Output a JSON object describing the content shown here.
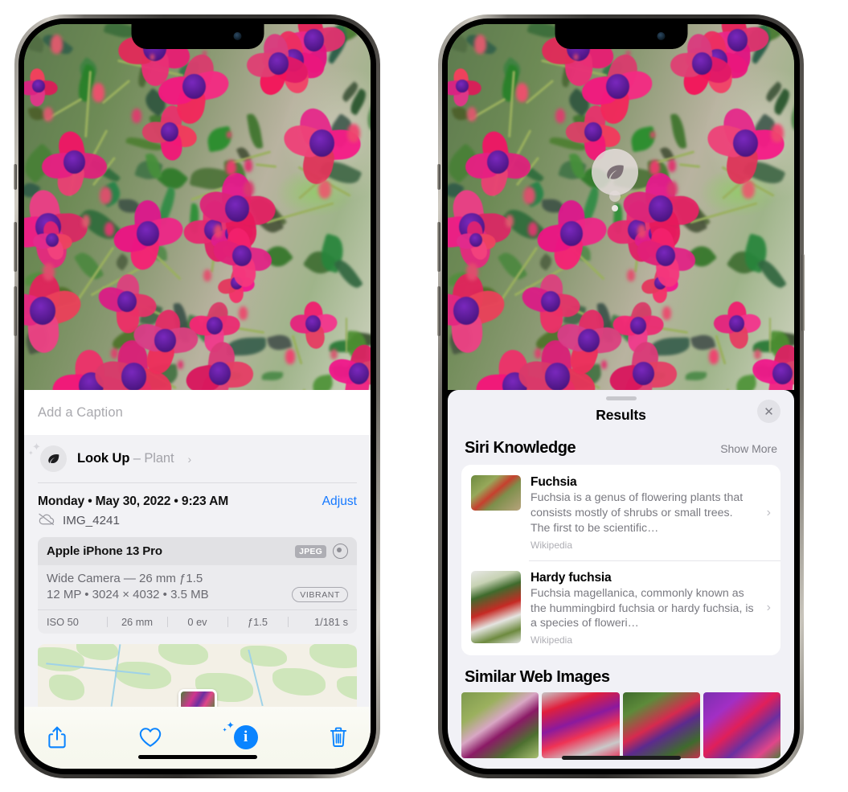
{
  "left_phone": {
    "caption_field": {
      "placeholder": "Add a Caption",
      "value": ""
    },
    "lookup_row": {
      "icon": "leaf-icon",
      "sparkle_icon": "sparkles-icon",
      "label": "Look Up",
      "separator": "–",
      "subject": "Plant",
      "chevron": "›"
    },
    "date_row": {
      "datetime": "Monday • May 30, 2022 • 9:23 AM",
      "adjust_label": "Adjust"
    },
    "filename_row": {
      "icon": "cloud-slash-icon",
      "filename": "IMG_4241"
    },
    "exif": {
      "device": "Apple iPhone 13 Pro",
      "format_badge": "JPEG",
      "aperture_icon": "aperture-icon",
      "lens_line": "Wide Camera — 26 mm ƒ1.5",
      "size_line": "12 MP • 3024 × 4032 • 3.5 MB",
      "style_badge": "VIBRANT",
      "stats": [
        "ISO 50",
        "26 mm",
        "0 ev",
        "ƒ1.5",
        "1/181 s"
      ]
    },
    "map": {
      "pin": "photo-thumbnail-pin"
    },
    "toolbar": [
      {
        "name": "share-icon",
        "glyph": "share"
      },
      {
        "name": "favorite-heart-icon",
        "glyph": "heart"
      },
      {
        "name": "info-icon",
        "glyph": "info",
        "badge_char": "i",
        "active": true
      },
      {
        "name": "trash-icon",
        "glyph": "trash"
      }
    ]
  },
  "right_phone": {
    "visual_lookup_badge": {
      "icon": "leaf-icon"
    },
    "sheet": {
      "grabber": "drag-handle",
      "title": "Results",
      "close_label": "✕"
    },
    "siri_knowledge": {
      "heading": "Siri Knowledge",
      "show_more": "Show More",
      "items": [
        {
          "title": "Fuchsia",
          "description": "Fuchsia is a genus of flowering plants that consists mostly of shrubs or small trees. The first to be scientific…",
          "source": "Wikipedia",
          "chevron": "›"
        },
        {
          "title": "Hardy fuchsia",
          "description": "Fuchsia magellanica, commonly known as the hummingbird fuchsia or hardy fuchsia, is a species of floweri…",
          "source": "Wikipedia",
          "chevron": "›"
        }
      ]
    },
    "similar_web_images": {
      "heading": "Similar Web Images",
      "count": 4
    }
  },
  "colors": {
    "accent_blue": "#0a84ff",
    "sheet_gray": "#f1f1f6",
    "card_white": "#ffffff",
    "secondary_text": "#7a7a81"
  }
}
